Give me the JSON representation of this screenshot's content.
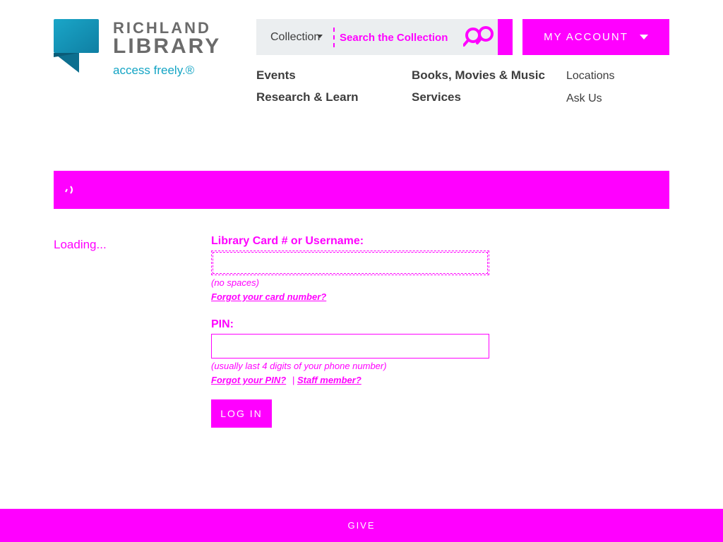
{
  "logo": {
    "name_line1": "RICHLAND",
    "name_line2": "LIBRARY",
    "tagline": "access freely.®"
  },
  "search": {
    "collection_label": "Collection",
    "placeholder": "Search the Collection",
    "icon": "search-icon"
  },
  "account": {
    "label": "MY ACCOUNT",
    "icon": "chevron-down-icon"
  },
  "nav": {
    "primary": [
      "Events",
      "Research & Learn",
      "Books, Movies & Music",
      "Services"
    ],
    "secondary": [
      "Locations",
      "Ask Us"
    ]
  },
  "login": {
    "loading_text": "Loading...",
    "card_label": "Library Card # or Username:",
    "card_value": "",
    "card_hint": "(no spaces)",
    "forgot_card": "Forgot your card number?",
    "pin_label": "PIN:",
    "pin_value": "",
    "pin_hint": "(usually last 4 digits of your phone number)",
    "forgot_pin": "Forgot your PIN?",
    "separator": "|",
    "staff_member": "Staff member?",
    "login_button": "LOG IN"
  },
  "footer": {
    "give_label": "GIVE"
  },
  "colors": {
    "accent": "#ff00ff",
    "brand_teal": "#13a4c4",
    "brand_gray": "#6b6b6b",
    "search_bg": "#ebeef0"
  }
}
